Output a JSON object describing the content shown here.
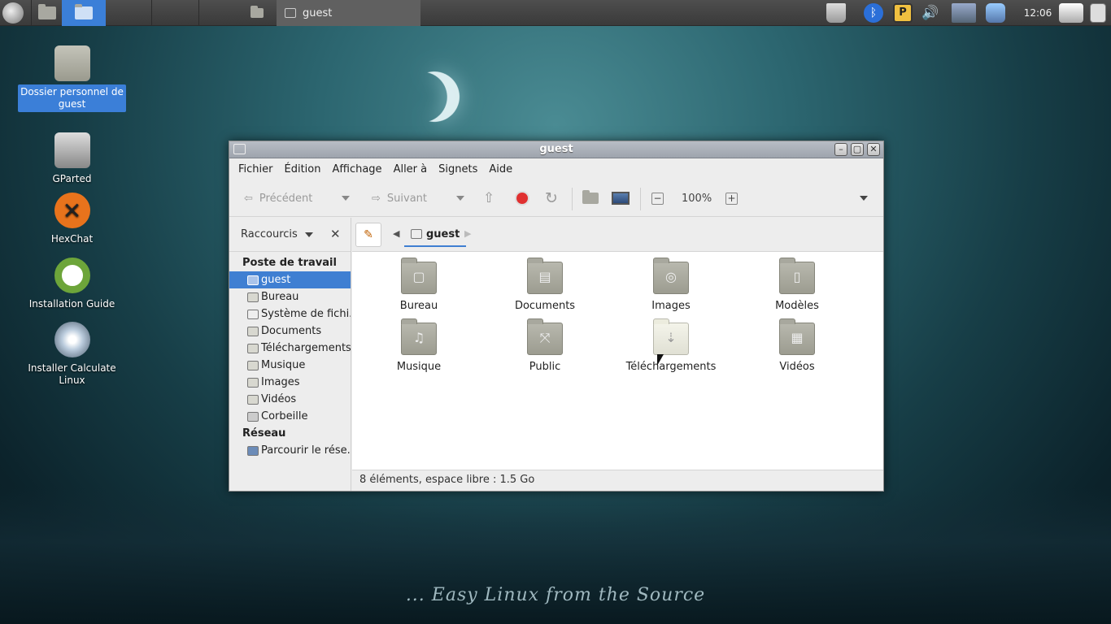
{
  "panel": {
    "task_title": "guest",
    "clock": "12:06",
    "tray_icons": [
      "trash-icon",
      "bluetooth-icon",
      "parcellite-icon",
      "volume-icon",
      "network-icon",
      "storage-icon",
      "update-icon",
      "battery-icon"
    ]
  },
  "desktop": {
    "icons": [
      {
        "label": "Dossier personnel de guest",
        "icon": "home-folder-icon"
      },
      {
        "label": "GParted",
        "icon": "gparted-icon"
      },
      {
        "label": "HexChat",
        "icon": "hexchat-icon"
      },
      {
        "label": "Installation Guide",
        "icon": "lifebuoy-icon"
      },
      {
        "label": "Installer Calculate Linux",
        "icon": "installer-disc-icon"
      }
    ],
    "slogan": "... Easy Linux from the Source"
  },
  "window": {
    "title": "guest",
    "menu": [
      "Fichier",
      "Édition",
      "Affichage",
      "Aller à",
      "Signets",
      "Aide"
    ],
    "toolbar": {
      "back": "Précédent",
      "forward": "Suivant",
      "zoom": "100%"
    },
    "sidebar": {
      "header": "Raccourcis",
      "section_places": "Poste de travail",
      "places": [
        "guest",
        "Bureau",
        "Système de fichi...",
        "Documents",
        "Téléchargements",
        "Musique",
        "Images",
        "Vidéos",
        "Corbeille"
      ],
      "section_network": "Réseau",
      "network": [
        "Parcourir le rése..."
      ]
    },
    "path": {
      "current": "guest"
    },
    "files": [
      {
        "name": "Bureau",
        "glyph": "▢"
      },
      {
        "name": "Documents",
        "glyph": "▤"
      },
      {
        "name": "Images",
        "glyph": "◎"
      },
      {
        "name": "Modèles",
        "glyph": "▯"
      },
      {
        "name": "Musique",
        "glyph": "♫"
      },
      {
        "name": "Public",
        "glyph": "⤧"
      },
      {
        "name": "Téléchargements",
        "glyph": "⇣"
      },
      {
        "name": "Vidéos",
        "glyph": "▦"
      }
    ],
    "status": "8 éléments, espace libre : 1.5 Go"
  }
}
